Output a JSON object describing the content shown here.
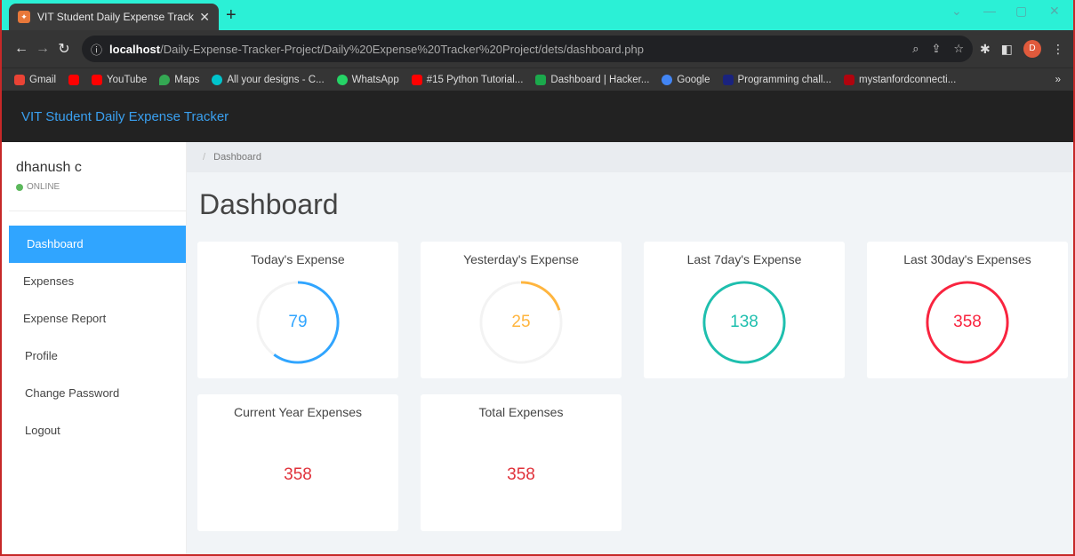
{
  "browser": {
    "tab_title": "VIT Student Daily Expense Tracke",
    "tab_icon": "app-favicon",
    "url_host": "localhost",
    "url_path": "/Daily-Expense-Tracker-Project/Daily%20Expense%20Tracker%20Project/dets/dashboard.php",
    "profile_initial": "D",
    "bookmarks": [
      {
        "label": "Gmail",
        "color": "#ea4335"
      },
      {
        "label": "",
        "color": "#ff0000"
      },
      {
        "label": "YouTube",
        "color": "#ff0000"
      },
      {
        "label": "Maps",
        "color": "#34a853"
      },
      {
        "label": "All your designs - C...",
        "color": "#00c4cc"
      },
      {
        "label": "WhatsApp",
        "color": "#25d366"
      },
      {
        "label": "#15 Python Tutorial...",
        "color": "#ff0000"
      },
      {
        "label": "Dashboard | Hacker...",
        "color": "#1ba94c"
      },
      {
        "label": "Google",
        "color": "#4285f4"
      },
      {
        "label": "Programming chall...",
        "color": "#1a237e"
      },
      {
        "label": "mystanfordconnecti...",
        "color": "#b1040e"
      }
    ],
    "bookmarks_overflow": "»"
  },
  "app": {
    "brand": "VIT Student Daily Expense Tracker",
    "user_name": "dhanush c",
    "user_status": "ONLINE"
  },
  "sidebar": {
    "items": [
      {
        "label": "Dashboard",
        "active": true
      },
      {
        "label": "Expenses"
      },
      {
        "label": "Expense Report"
      },
      {
        "label": "Profile"
      },
      {
        "label": "Change Password"
      },
      {
        "label": "Logout"
      }
    ]
  },
  "main": {
    "breadcrumb": "Dashboard",
    "title": "Dashboard",
    "cards": [
      {
        "title": "Today's Expense",
        "value": "79",
        "color": "#30a5ff",
        "ring_fraction": 0.6
      },
      {
        "title": "Yesterday's Expense",
        "value": "25",
        "color": "#ffb53e",
        "ring_fraction": 0.2
      },
      {
        "title": "Last 7day's Expense",
        "value": "138",
        "color": "#1ebfae",
        "ring_fraction": 1.0
      },
      {
        "title": "Last 30day's Expenses",
        "value": "358",
        "color": "#f9243f",
        "ring_fraction": 1.0
      },
      {
        "title": "Current Year Expenses",
        "value": "358",
        "color": "#e0313a"
      },
      {
        "title": "Total Expenses",
        "value": "358",
        "color": "#e0313a"
      }
    ]
  }
}
